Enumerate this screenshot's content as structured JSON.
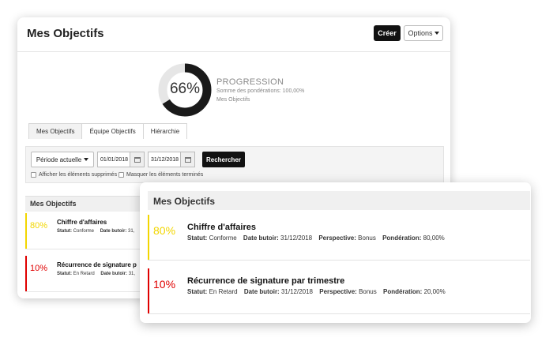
{
  "colors": {
    "dark": "#111111",
    "progress_arc": "#1a1a1a",
    "progress_track": "#e6e6e6",
    "yellow": "#f2d600",
    "red": "#e00000"
  },
  "header": {
    "title": "Mes Objectifs",
    "create_label": "Créer",
    "options_label": "Options"
  },
  "progress": {
    "percent": 66,
    "percent_label": "66%",
    "title": "PROGRESSION",
    "weight_sum": "Somme des pondérations: 100,00%",
    "scope": "Mes Objectifs"
  },
  "tabs": [
    {
      "label": "Mes Objectifs",
      "active": true
    },
    {
      "label": "Équipe Objectifs",
      "active": false
    },
    {
      "label": "Hiérarchie",
      "active": false
    }
  ],
  "filters": {
    "period_label": "Période actuelle",
    "date_from": "01/01/2018",
    "date_to": "31/12/2018",
    "search_label": "Rechercher",
    "show_deleted": "Afficher les éléments supprimés",
    "hide_finished": "Masquer les éléments terminés"
  },
  "section_title": "Mes Objectifs",
  "labels": {
    "status": "Statut:",
    "due": "Date butoir:",
    "perspective": "Perspective:",
    "weight": "Pondération:"
  },
  "back_items": [
    {
      "percent": "80%",
      "title": "Chiffre d'affaires",
      "status": "Conforme",
      "due": "31,",
      "color": "yellow"
    },
    {
      "percent": "10%",
      "title": "Récurrence de signature p",
      "status": "En Retard",
      "due": "31,",
      "color": "red"
    }
  ],
  "objectives": [
    {
      "percent": "80%",
      "title": "Chiffre d'affaires",
      "status": "Conforme",
      "due": "31/12/2018",
      "perspective": "Bonus",
      "weight": "80,00%",
      "color": "yellow"
    },
    {
      "percent": "10%",
      "title": "Récurrence de signature par trimestre",
      "status": "En Retard",
      "due": "31/12/2018",
      "perspective": "Bonus",
      "weight": "20,00%",
      "color": "red"
    }
  ]
}
